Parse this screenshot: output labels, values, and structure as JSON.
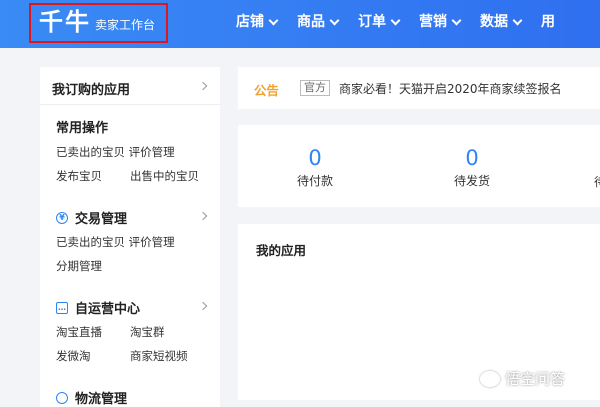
{
  "header": {
    "logo_main": "千牛",
    "logo_sub": "卖家工作台",
    "nav": [
      "店铺",
      "商品",
      "订单",
      "营销",
      "数据",
      "用"
    ]
  },
  "sidebar": {
    "title": "我订购的应用",
    "sections": [
      {
        "title": "常用操作",
        "icon": "",
        "links": [
          "已卖出的宝贝 评价管理",
          "发布宝贝",
          "出售中的宝贝"
        ]
      },
      {
        "title": "交易管理",
        "icon": "yen-icon",
        "links": [
          "已卖出的宝贝 评价管理",
          "分期管理"
        ]
      },
      {
        "title": "自运营中心",
        "icon": "chat-icon",
        "links": [
          "淘宝直播",
          "淘宝群",
          "发微淘",
          "商家短视频"
        ]
      },
      {
        "title": "物流管理",
        "icon": "truck-icon",
        "links": []
      }
    ]
  },
  "notice": {
    "label": "公告",
    "tag": "官方",
    "text": "商家必看！天猫开启2020年商家续签报名"
  },
  "stats": [
    {
      "value": "0",
      "label": "待付款"
    },
    {
      "value": "0",
      "label": "待发货"
    },
    {
      "value": "",
      "label": "待"
    }
  ],
  "apps": {
    "title": "我的应用"
  },
  "watermark": "悟空问答",
  "colors": {
    "header": "#2f6ff0",
    "accent": "#2f84f4",
    "notice": "#f2a230",
    "highlight_box": "#e0161a"
  }
}
